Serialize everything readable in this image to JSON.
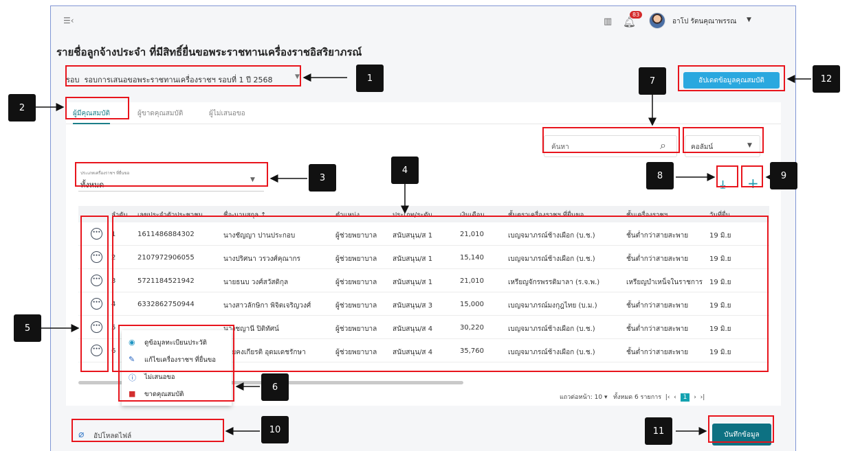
{
  "app": {
    "notification_count": "83",
    "username": "อาโป รัตนคุณาพรรณ",
    "page_title": "รายชื่อลูกจ้างประจำ ที่มีสิทธิ์ยื่นขอพระราชทานเครื่องราชอิสริยาภรณ์"
  },
  "round": {
    "label": "รอบ",
    "value": "รอบการเสนอขอพระราชทานเครื่องราชฯ รอบที่ 1 ปี 2568"
  },
  "update_button": "อัปเดตข้อมูลคุณสมบัติ",
  "tabs": [
    {
      "label": "ผู้มีคุณสมบัติ",
      "active": true
    },
    {
      "label": "ผู้ขาดคุณสมบัติ",
      "active": false
    },
    {
      "label": "ผู้ไม่เสนอขอ",
      "active": false
    }
  ],
  "search": {
    "placeholder": "ค้นหา"
  },
  "column_select": {
    "label": "คอลัมน์"
  },
  "type_filter": {
    "label": "ประเภทเครื่องราชฯ ที่ยื่นขอ",
    "value": "ทั้งหมด"
  },
  "table": {
    "headers": [
      "ลำดับ",
      "เลขประจำตัวประชาชน",
      "ชื่อ-นามสกุล ↑",
      "ตำแหน่ง",
      "ประเภท/ระดับ",
      "เงินเดือน",
      "ชั้นตราเครื่องราชฯ ที่ยื่นขอ",
      "ชั้นเครื่องราชฯ",
      "วันที่ยื่น"
    ],
    "rows": [
      [
        "1",
        "1611486884302",
        "นางชัญญา ปานประกอบ",
        "ผู้ช่วยพยาบาล",
        "สนับสนุน/ส 1",
        "21,010",
        "เบญจมาภรณ์ช้างเผือก (บ.ช.)",
        "ชั้นต่ำกว่าสายสะพาย",
        "19 มิ.ย"
      ],
      [
        "2",
        "2107972906055",
        "นางปริศนา วรวงศ์คุณากร",
        "ผู้ช่วยพยาบาล",
        "สนับสนุน/ส 1",
        "15,140",
        "เบญจมาภรณ์ช้างเผือก (บ.ช.)",
        "ชั้นต่ำกว่าสายสะพาย",
        "19 มิ.ย"
      ],
      [
        "3",
        "5721184521942",
        "นายธนบ วงศ์สวัสดิกุล",
        "ผู้ช่วยพยาบาล",
        "สนับสนุน/ส 1",
        "21,010",
        "เหรียญจักรพรรดิมาลา (ร.จ.พ.)",
        "เหรียญบำเหน็จในราชการ",
        "19 มิ.ย"
      ],
      [
        "4",
        "6332862750944",
        "นางสาวลักษิกา พิจิตเจริญวงศ์",
        "ผู้ช่วยพยาบาล",
        "สนับสนุน/ส 3",
        "15,000",
        "เบญจมาภรณ์มงกุฎไทย (บ.ม.)",
        "ชั้นต่ำกว่าสายสะพาย",
        "19 มิ.ย"
      ],
      [
        "5",
        "",
        "นางชญานี ปิติทัศน์",
        "ผู้ช่วยพยาบาล",
        "สนับสนุน/ส 4",
        "30,220",
        "เบญจมาภรณ์ช้างเผือก (บ.ช.)",
        "ชั้นต่ำกว่าสายสะพาย",
        "19 มิ.ย"
      ],
      [
        "6",
        "",
        "นายคงเกียรติ อุดมเดชรักษา",
        "ผู้ช่วยพยาบาล",
        "สนับสนุน/ส 4",
        "35,760",
        "เบญจมาภรณ์ช้างเผือก (บ.ช.)",
        "ชั้นต่ำกว่าสายสะพาย",
        "19 มิ.ย"
      ]
    ]
  },
  "row_menu": [
    {
      "label": "ดูข้อมูลทะเบียนประวัติ",
      "icon": "eye-icon",
      "color": "#2196c4"
    },
    {
      "label": "แก้ไขเครื่องราชฯ ที่ยื่นขอ",
      "icon": "pencil-icon",
      "color": "#1f5fbf"
    },
    {
      "label": "ไม่เสนอขอ",
      "icon": "info-icon",
      "color": "#1f5fbf"
    },
    {
      "label": "ขาดคุณสมบัติ",
      "icon": "trash-icon",
      "color": "#d32f2f"
    }
  ],
  "pagination": {
    "rows_per_page_label": "แถวต่อหน้า:",
    "rows_per_page": "10",
    "total": "ทั้งหมด 6 รายการ",
    "current_page": "1"
  },
  "upload_label": "อัปโหลดไฟล์",
  "save_button": "บันทึกข้อมูล",
  "callouts": [
    "1",
    "2",
    "3",
    "4",
    "5",
    "6",
    "7",
    "8",
    "9",
    "10",
    "11",
    "12"
  ],
  "colors": {
    "accent": "#1b7e88",
    "primary_button": "#2aa8df",
    "save_button": "#0d7182",
    "highlight": "#e8141c"
  }
}
